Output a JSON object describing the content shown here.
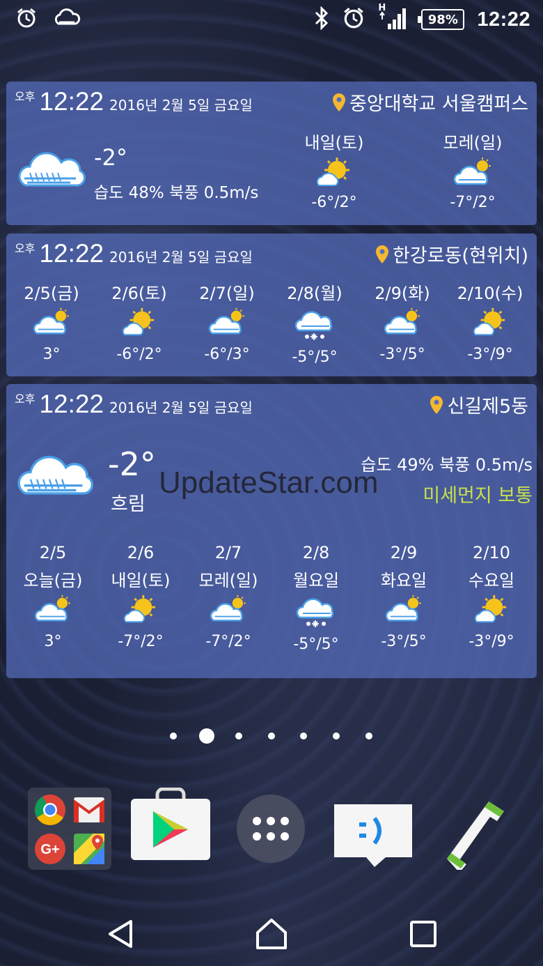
{
  "status_bar": {
    "time": "12:22",
    "battery": "98%",
    "left_icons": [
      "alarm-icon",
      "weather-icon"
    ],
    "right_icons": [
      "bluetooth-icon",
      "alarm-icon",
      "signal-icon",
      "battery-icon"
    ],
    "network_label": "H"
  },
  "widget1": {
    "ampm": "오후",
    "time": "12:22",
    "date": "2016년 2월 5일 금요일",
    "location": "중앙대학교 서울캠퍼스",
    "current_temp": "-2°",
    "humidity_wind": "습도 48% 북풍 0.5m/s",
    "forecast": [
      {
        "label": "내일(토)",
        "temp": "-6°/2°",
        "icon": "sun-cloud-icon"
      },
      {
        "label": "모레(일)",
        "temp": "-7°/2°",
        "icon": "cloud-sun-icon"
      }
    ]
  },
  "widget2": {
    "ampm": "오후",
    "time": "12:22",
    "date": "2016년 2월 5일 금요일",
    "location": "한강로동(현위치)",
    "forecast": [
      {
        "label": "2/5(금)",
        "temp": "3°",
        "icon": "cloud-sun-icon"
      },
      {
        "label": "2/6(토)",
        "temp": "-6°/2°",
        "icon": "sun-cloud-icon"
      },
      {
        "label": "2/7(일)",
        "temp": "-6°/3°",
        "icon": "cloud-sun-icon"
      },
      {
        "label": "2/8(월)",
        "temp": "-5°/5°",
        "icon": "cloud-snow-icon"
      },
      {
        "label": "2/9(화)",
        "temp": "-3°/5°",
        "icon": "cloud-sun-icon"
      },
      {
        "label": "2/10(수)",
        "temp": "-3°/9°",
        "icon": "sun-cloud-icon"
      }
    ]
  },
  "widget3": {
    "ampm": "오후",
    "time": "12:22",
    "date": "2016년 2월 5일 금요일",
    "location": "신길제5동",
    "current_temp": "-2°",
    "condition": "흐림",
    "humidity_wind": "습도 49% 북풍 0.5m/s",
    "fine_dust": "미세먼지 보통",
    "fine_dust_color": "#c8e04a",
    "forecast": [
      {
        "date": "2/5",
        "label": "오늘(금)",
        "temp": "3°",
        "icon": "cloud-sun-icon"
      },
      {
        "date": "2/6",
        "label": "내일(토)",
        "temp": "-7°/2°",
        "icon": "sun-cloud-icon"
      },
      {
        "date": "2/7",
        "label": "모레(일)",
        "temp": "-7°/2°",
        "icon": "cloud-sun-icon"
      },
      {
        "date": "2/8",
        "label": "월요일",
        "temp": "-5°/5°",
        "icon": "cloud-snow-icon"
      },
      {
        "date": "2/9",
        "label": "화요일",
        "temp": "-3°/5°",
        "icon": "cloud-sun-icon"
      },
      {
        "date": "2/10",
        "label": "수요일",
        "temp": "-3°/9°",
        "icon": "sun-cloud-icon"
      }
    ]
  },
  "watermark": "UpdateStar.com",
  "page_indicator": {
    "pages": 7,
    "active": 2
  },
  "dock": {
    "folder_apps": [
      "chrome-icon",
      "gmail-icon",
      "google-plus-icon",
      "maps-icon"
    ],
    "apps": [
      "play-store-icon",
      "app-drawer-icon",
      "messaging-icon",
      "phone-icon"
    ]
  },
  "navigation": [
    "back-button",
    "home-button",
    "recents-button"
  ]
}
